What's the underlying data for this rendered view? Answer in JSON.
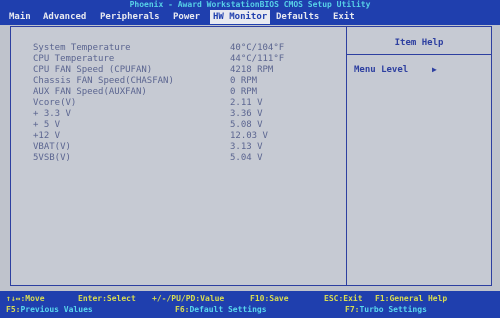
{
  "title": "Phoenix - Award WorkstationBIOS CMOS Setup Utility",
  "menu": [
    {
      "label": "Main"
    },
    {
      "label": "Advanced"
    },
    {
      "label": "Peripherals"
    },
    {
      "label": "Power"
    },
    {
      "label": "HW Monitor"
    },
    {
      "label": "Defaults"
    },
    {
      "label": "Exit"
    }
  ],
  "active_menu": "HW Monitor",
  "rows": [
    {
      "label": "System Temperature",
      "value": "40°C/104°F"
    },
    {
      "label": "CPU Temperature",
      "value": "44°C/111°F"
    },
    {
      "label": "CPU FAN Speed (CPUFAN)",
      "value": "4218 RPM"
    },
    {
      "label": "Chassis FAN Speed(CHASFAN)",
      "value": "  0 RPM"
    },
    {
      "label": "AUX FAN Speed(AUXFAN)",
      "value": "  0 RPM"
    },
    {
      "label": "Vcore(V)",
      "value": " 2.11 V"
    },
    {
      "label": "+ 3.3 V",
      "value": " 3.36 V"
    },
    {
      "label": "+ 5 V",
      "value": " 5.08 V"
    },
    {
      "label": "+12 V",
      "value": "12.03 V"
    },
    {
      "label": "VBAT(V)",
      "value": " 3.13 V"
    },
    {
      "label": "5VSB(V)",
      "value": " 5.04 V"
    }
  ],
  "help": {
    "title": "Item Help",
    "menu_level_label": "Menu Level",
    "menu_level_arrow": "▶"
  },
  "footer": [
    {
      "key": "↑↓↔:Move",
      "desc": ""
    },
    {
      "key": "Enter:Select",
      "desc": ""
    },
    {
      "key": "+/-/PU/PD:Value",
      "desc": ""
    },
    {
      "key": "F10:Save",
      "desc": ""
    },
    {
      "key": "ESC:Exit",
      "desc": ""
    },
    {
      "key": "F1:General Help",
      "desc": ""
    },
    {
      "key": "F5:",
      "desc": "Previous Values"
    },
    {
      "key": "F6:",
      "desc": "Default Settings"
    },
    {
      "key": "F7:",
      "desc": "Turbo Settings"
    }
  ],
  "colors": {
    "menubar_bg": "#1f3fae",
    "screen_bg": "#c6cad3",
    "text": "#5b6590",
    "footer_key": "#d9dd52",
    "footer_desc": "#59d7ed"
  }
}
